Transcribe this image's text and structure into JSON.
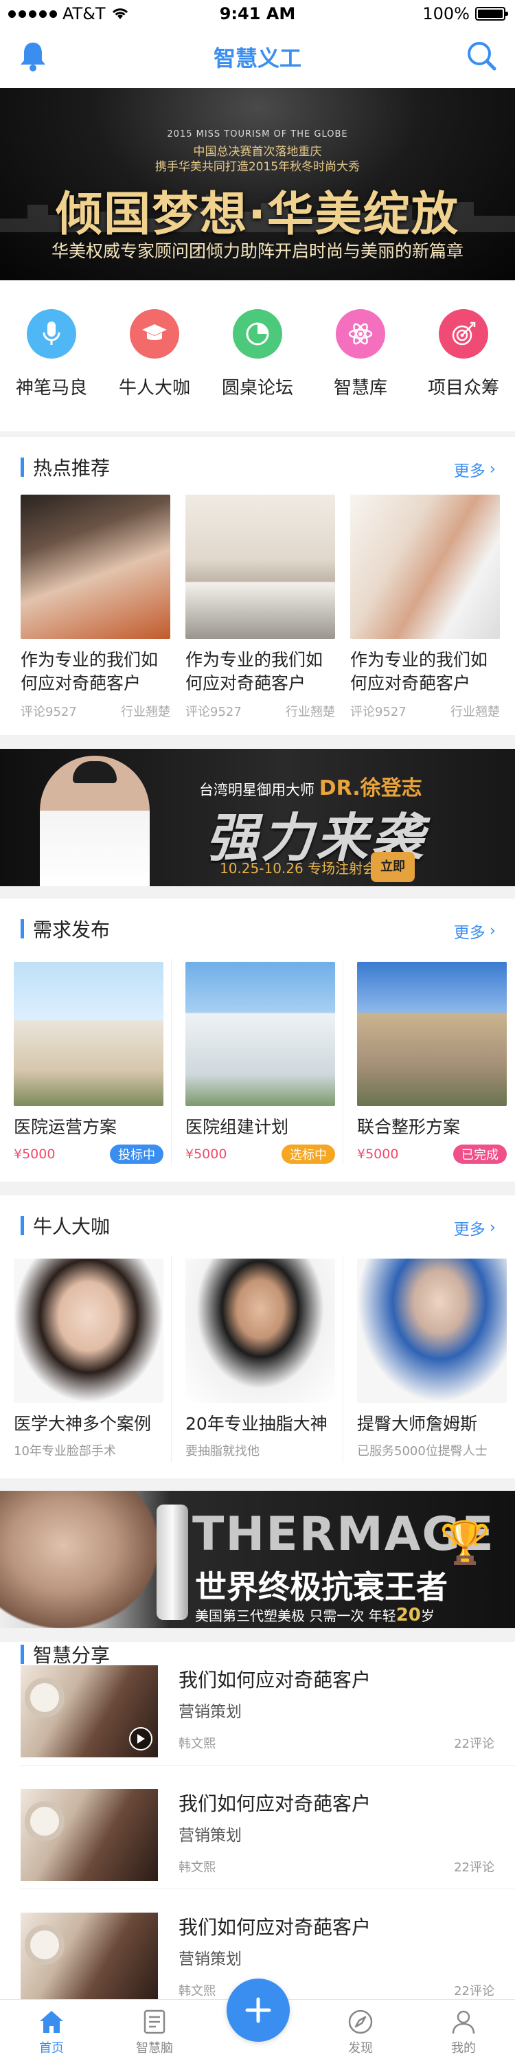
{
  "status_bar": {
    "carrier": "AT&T",
    "time": "9:41 AM",
    "battery": "100%"
  },
  "nav": {
    "title": "智慧义工"
  },
  "banner_top": {
    "line1": "2015 MISS TOURISM OF THE GLOBE",
    "line2": "中国总决赛首次落地重庆",
    "line3": "携手华美共同打造2015年秋冬时尚大秀",
    "headline": "倾国梦想·华美绽放",
    "tagline": "华美权威专家顾问团倾力助阵开启时尚与美丽的新篇章"
  },
  "quick_actions": [
    {
      "label": "神笔马良",
      "color": "#4fb7f5",
      "icon": "microphone-icon"
    },
    {
      "label": "牛人大咖",
      "color": "#f26a6a",
      "icon": "graduation-cap-icon"
    },
    {
      "label": "圆桌论坛",
      "color": "#4cc97a",
      "icon": "pie-chart-icon"
    },
    {
      "label": "智慧库",
      "color": "#f56fbf",
      "icon": "atom-icon"
    },
    {
      "label": "项目众筹",
      "color": "#f04b74",
      "icon": "target-icon"
    }
  ],
  "hot": {
    "title": "热点推荐",
    "more": "更多",
    "items": [
      {
        "title": "作为专业的我们如何应对奇葩客户",
        "comments": "评论9527",
        "source": "行业翘楚"
      },
      {
        "title": "作为专业的我们如何应对奇葩客户",
        "comments": "评论9527",
        "source": "行业翘楚"
      },
      {
        "title": "作为专业的我们如何应对奇葩客户",
        "comments": "评论9527",
        "source": "行业翘楚"
      }
    ]
  },
  "banner_mid": {
    "kicker": "台湾明星御用大师",
    "doctor": "DR.徐登志",
    "headline": "强力来袭",
    "date": "10.25-10.26 专场注射会",
    "badge": "立即"
  },
  "demand": {
    "title": "需求发布",
    "more": "更多",
    "items": [
      {
        "title": "医院运营方案",
        "price": "¥5000",
        "status": "投标中",
        "status_color": "#3a8ef0"
      },
      {
        "title": "医院组建计划",
        "price": "¥5000",
        "status": "选标中",
        "status_color": "#f5a623"
      },
      {
        "title": "联合整形方案",
        "price": "¥5000",
        "status": "已完成",
        "status_color": "#f0508a"
      }
    ]
  },
  "experts": {
    "title": "牛人大咖",
    "more": "更多",
    "items": [
      {
        "title": "医学大神多个案例",
        "desc": "10年专业脸部手术"
      },
      {
        "title": "20年专业抽脂大神",
        "desc": "要抽脂就找他"
      },
      {
        "title": "提臀大师詹姆斯",
        "desc": "已服务5000位提臀人士"
      }
    ]
  },
  "banner_bottom": {
    "brand": "THERMAGE",
    "slogan": "世界终极抗衰王者",
    "foot_pre": "美国第三代塑美极 只需一次 年轻",
    "foot_num": "20",
    "foot_post": "岁"
  },
  "share": {
    "title": "智慧分享",
    "items": [
      {
        "title": "我们如何应对奇葩客户",
        "category": "营销策划",
        "author": "韩文熙",
        "comments": "22评论"
      },
      {
        "title": "我们如何应对奇葩客户",
        "category": "营销策划",
        "author": "韩文熙",
        "comments": "22评论"
      },
      {
        "title": "我们如何应对奇葩客户",
        "category": "营销策划",
        "author": "韩文熙",
        "comments": "22评论"
      }
    ]
  },
  "tabbar": {
    "items": [
      {
        "label": "首页",
        "icon": "home-icon",
        "active": true
      },
      {
        "label": "智慧脑",
        "icon": "document-icon",
        "active": false
      },
      {
        "label": "发现",
        "icon": "compass-icon",
        "active": false
      },
      {
        "label": "我的",
        "icon": "user-icon",
        "active": false
      }
    ],
    "fab_icon": "plus-icon"
  }
}
